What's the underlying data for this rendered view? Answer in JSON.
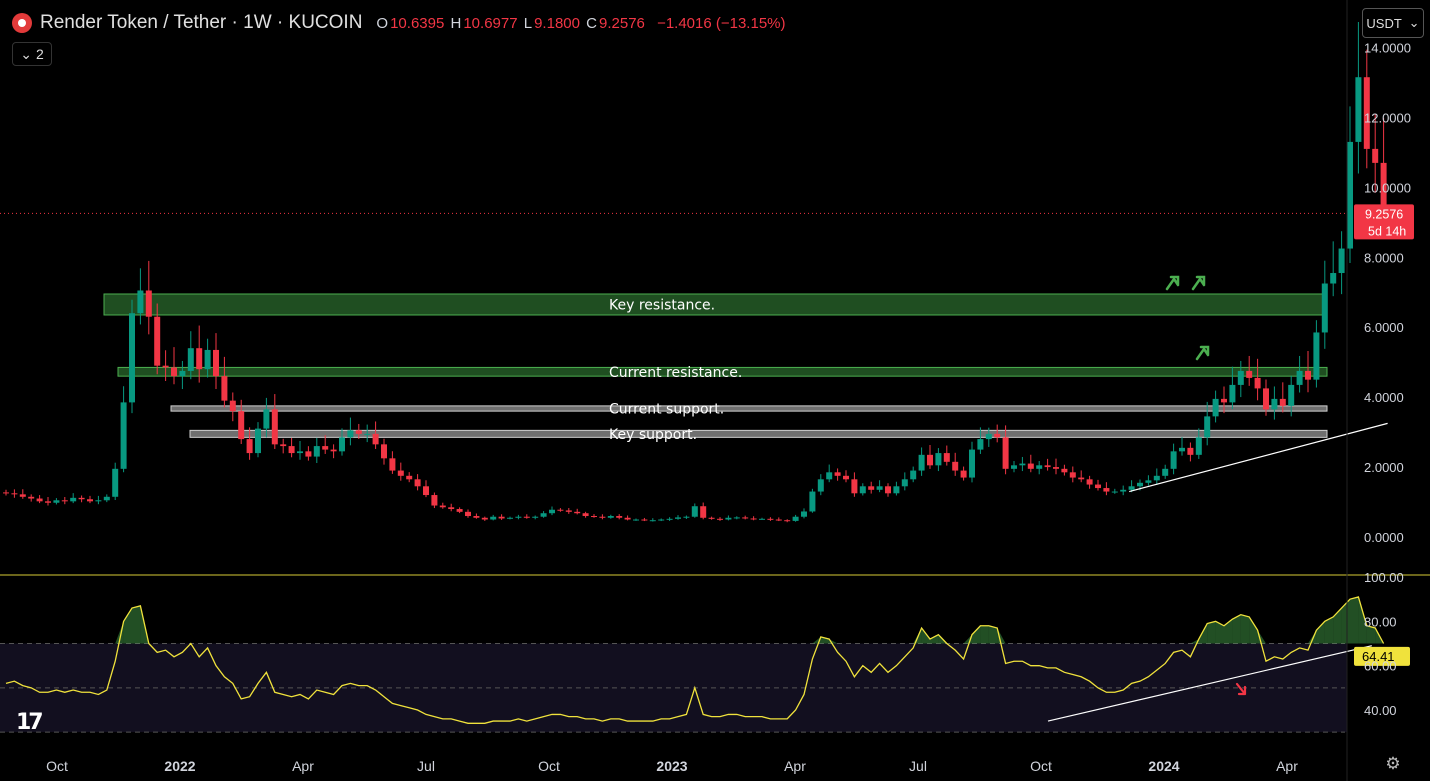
{
  "header": {
    "title": "Render Token / Tether · 1W · KUCOIN",
    "open_label": "O",
    "open": "10.6395",
    "high_label": "H",
    "high": "10.6977",
    "low_label": "L",
    "low": "9.1800",
    "close_label": "C",
    "close": "9.2576",
    "change": "−1.4016 (−13.15%)",
    "indicator_count": "2"
  },
  "currency_selector": "USDT",
  "last_price": {
    "value": "9.2576",
    "countdown": "5d 14h"
  },
  "rsi_value": "64.41",
  "colors": {
    "up": "#089981",
    "down": "#f23645",
    "rsi": "#f0e23c",
    "zone": "#2e7d32",
    "support": "#9e9e9e"
  },
  "chart_data": [
    {
      "type": "candlestick",
      "interval": "1W",
      "y_ticks": [
        "14.0000",
        "12.0000",
        "10.0000",
        "8.0000",
        "6.0000",
        "4.0000",
        "2.0000",
        "0.0000"
      ],
      "ylim": [
        0,
        14
      ],
      "x_ticks": [
        "Oct",
        "2022",
        "Apr",
        "Jul",
        "Oct",
        "2023",
        "Apr",
        "Jul",
        "Oct",
        "2024",
        "Apr"
      ],
      "closes": [
        1.25,
        1.22,
        1.15,
        1.1,
        1.02,
        0.98,
        1.05,
        1.02,
        1.12,
        1.08,
        1.02,
        1.05,
        1.15,
        1.95,
        3.85,
        6.4,
        7.05,
        6.3,
        4.9,
        4.85,
        4.6,
        4.75,
        5.4,
        4.8,
        5.35,
        4.6,
        3.9,
        3.6,
        2.8,
        2.4,
        3.1,
        3.65,
        2.65,
        2.6,
        2.4,
        2.45,
        2.3,
        2.6,
        2.5,
        2.45,
        2.85,
        3.05,
        2.95,
        2.95,
        2.65,
        2.25,
        1.9,
        1.75,
        1.65,
        1.45,
        1.2,
        0.9,
        0.85,
        0.8,
        0.72,
        0.6,
        0.55,
        0.5,
        0.58,
        0.53,
        0.55,
        0.58,
        0.55,
        0.58,
        0.68,
        0.78,
        0.76,
        0.72,
        0.68,
        0.6,
        0.58,
        0.55,
        0.6,
        0.55,
        0.5,
        0.5,
        0.48,
        0.48,
        0.5,
        0.52,
        0.56,
        0.58,
        0.88,
        0.55,
        0.52,
        0.5,
        0.55,
        0.56,
        0.53,
        0.52,
        0.52,
        0.5,
        0.48,
        0.46,
        0.58,
        0.73,
        1.3,
        1.65,
        1.85,
        1.75,
        1.65,
        1.25,
        1.45,
        1.35,
        1.45,
        1.25,
        1.45,
        1.65,
        1.9,
        2.35,
        2.05,
        2.4,
        2.15,
        1.9,
        1.7,
        2.5,
        2.8,
        2.95,
        2.85,
        1.95,
        2.05,
        2.1,
        1.95,
        2.05,
        2.0,
        1.95,
        1.85,
        1.7,
        1.65,
        1.5,
        1.4,
        1.3,
        1.3,
        1.35,
        1.45,
        1.55,
        1.62,
        1.75,
        1.95,
        2.45,
        2.55,
        2.35,
        2.85,
        3.45,
        3.95,
        3.85,
        4.35,
        4.75,
        4.55,
        4.25,
        3.65,
        3.95,
        3.75,
        4.35,
        4.75,
        4.5,
        5.85,
        7.25,
        7.55,
        8.25,
        11.3,
        13.15,
        11.1,
        10.7,
        9.26
      ],
      "current_price": 9.2576,
      "zones": [
        {
          "label": "Key resistance.",
          "low": 6.35,
          "high": 6.95,
          "color": "green"
        },
        {
          "label": "Current resistance.",
          "low": 4.6,
          "high": 4.85,
          "color": "green"
        },
        {
          "label": "Current support.",
          "low": 3.6,
          "high": 3.75,
          "color": "gray"
        },
        {
          "label": "Key support.",
          "low": 2.85,
          "high": 3.05,
          "color": "gray"
        }
      ],
      "trendline": {
        "from_index": 133,
        "from_value": 1.3,
        "to_index": 164,
        "to_value": 3.25
      }
    },
    {
      "type": "line",
      "indicator": "RSI",
      "y_ticks": [
        "100.00",
        "80.00",
        "60.00",
        "40.00"
      ],
      "ylim": [
        30,
        100
      ],
      "levels": [
        70,
        50,
        30
      ],
      "values": [
        52,
        53,
        51,
        50,
        48,
        48,
        49,
        48,
        49,
        48,
        48,
        47,
        49,
        62,
        80,
        86,
        87,
        70,
        66,
        67,
        64,
        66,
        70,
        64,
        68,
        60,
        55,
        52,
        45,
        46,
        52,
        57,
        48,
        47,
        46,
        47,
        45,
        49,
        48,
        47,
        51,
        52,
        51,
        51,
        49,
        46,
        43,
        42,
        41,
        40,
        38,
        37,
        36,
        36,
        35,
        34,
        34,
        34,
        35,
        35,
        35,
        36,
        35,
        36,
        37,
        38,
        38,
        37,
        37,
        36,
        36,
        35,
        36,
        36,
        35,
        35,
        35,
        35,
        36,
        36,
        37,
        38,
        50,
        38,
        37,
        37,
        38,
        38,
        37,
        37,
        37,
        36,
        36,
        36,
        40,
        47,
        63,
        73,
        72,
        66,
        62,
        55,
        60,
        57,
        61,
        57,
        60,
        64,
        68,
        77,
        72,
        74,
        70,
        67,
        63,
        74,
        78,
        78,
        77,
        61,
        62,
        62,
        60,
        60,
        59,
        59,
        57,
        56,
        55,
        53,
        50,
        48,
        48,
        49,
        52,
        53,
        55,
        58,
        61,
        66,
        67,
        64,
        72,
        79,
        80,
        78,
        81,
        83,
        82,
        76,
        62,
        64,
        63,
        66,
        68,
        67,
        76,
        80,
        82,
        86,
        90,
        91,
        78,
        77,
        70
      ],
      "current_value": 64.41,
      "trendline": {
        "from_index": 130,
        "from_value": 39,
        "to_index": 162,
        "to_value": 68
      }
    }
  ]
}
